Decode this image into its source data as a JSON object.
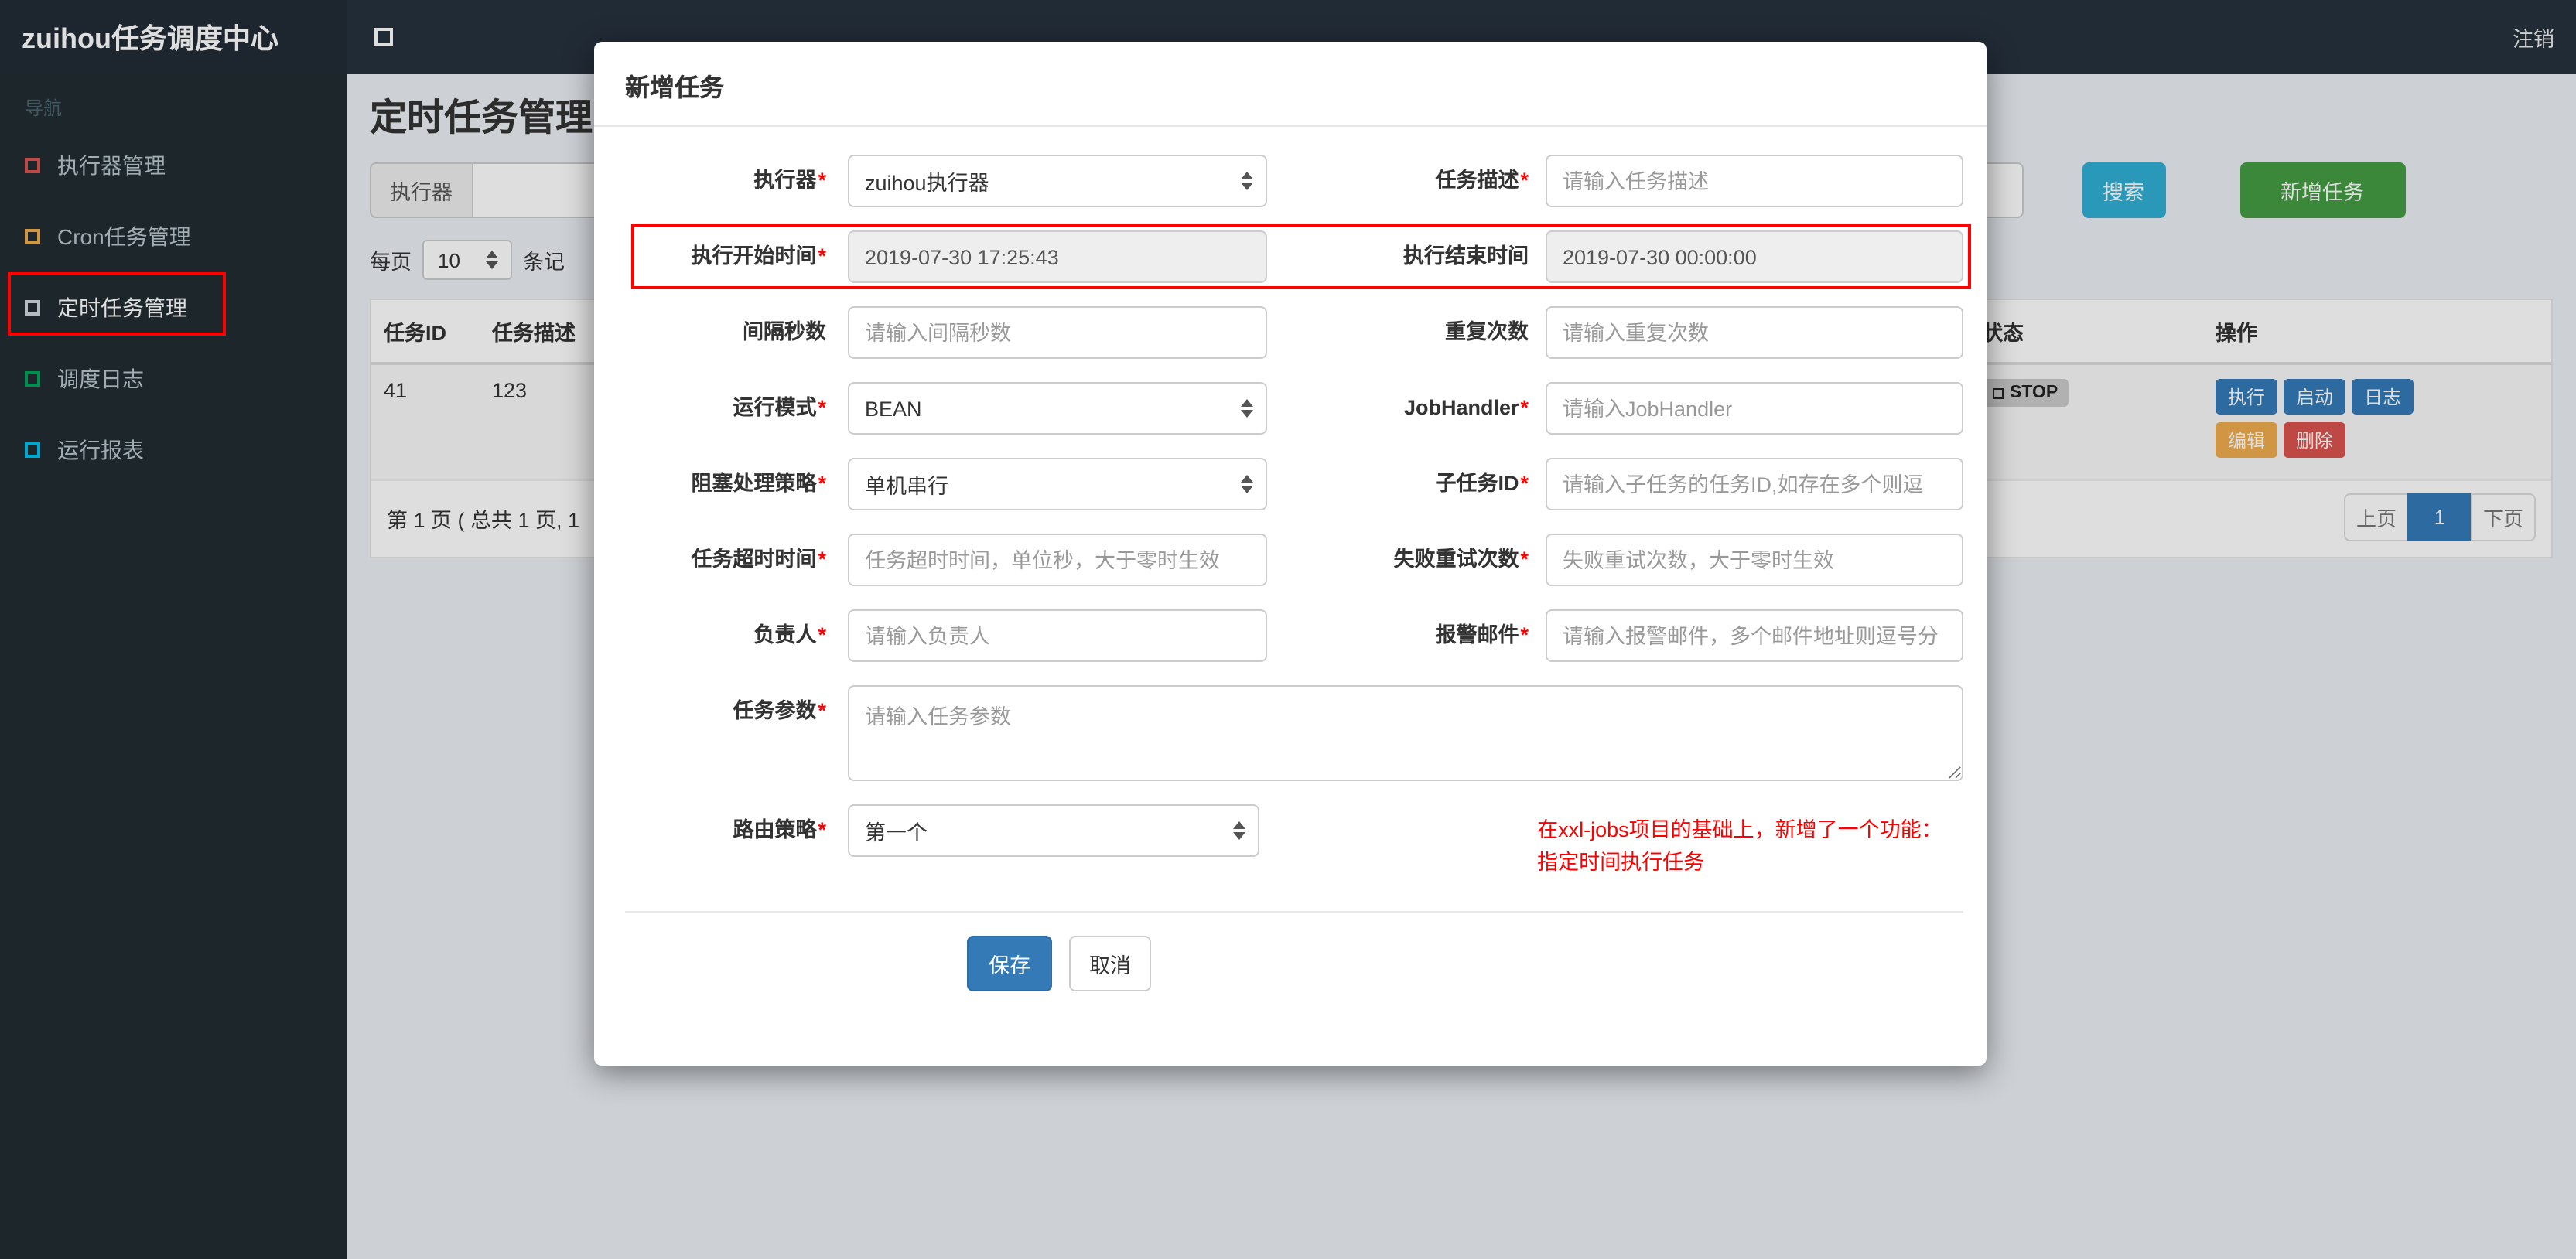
{
  "navbar": {
    "brand": "zuihou任务调度中心",
    "logout": "注销"
  },
  "sidebar": {
    "section_label": "导航",
    "items": [
      {
        "label": "执行器管理"
      },
      {
        "label": "Cron任务管理"
      },
      {
        "label": "定时任务管理"
      },
      {
        "label": "调度日志"
      },
      {
        "label": "运行报表"
      }
    ]
  },
  "page": {
    "title": "定时任务管理",
    "toolbar": {
      "filter_addon": "执行器",
      "search_label": "搜索",
      "add_label": "新增任务"
    },
    "per_page": {
      "prefix": "每页",
      "value": "10",
      "suffix": "条记"
    },
    "table": {
      "headers": [
        "任务ID",
        "任务描述",
        "状态",
        "操作"
      ],
      "row": {
        "id": "41",
        "description": "123",
        "status": "STOP",
        "actions": [
          {
            "label": "执行"
          },
          {
            "label": "启动"
          },
          {
            "label": "日志"
          },
          {
            "label": "编辑"
          },
          {
            "label": "删除"
          }
        ]
      }
    },
    "pagination": {
      "summary": "第 1 页 ( 总共 1 页, 1",
      "prev": "上页",
      "page": "1",
      "next": "下页"
    }
  },
  "modal": {
    "title": "新增任务",
    "required_marker": "*",
    "rows": [
      {
        "left": {
          "label": "执行器",
          "value": "zuihou执行器"
        },
        "right": {
          "label": "任务描述",
          "placeholder": "请输入任务描述"
        }
      },
      {
        "left": {
          "label": "执行开始时间",
          "value": "2019-07-30 17:25:43"
        },
        "right": {
          "label": "执行结束时间",
          "value": "2019-07-30 00:00:00"
        }
      },
      {
        "left": {
          "label": "间隔秒数",
          "placeholder": "请输入间隔秒数"
        },
        "right": {
          "label": "重复次数",
          "placeholder": "请输入重复次数"
        }
      },
      {
        "left": {
          "label": "运行模式",
          "value": "BEAN"
        },
        "right": {
          "label": "JobHandler",
          "placeholder": "请输入JobHandler"
        }
      },
      {
        "left": {
          "label": "阻塞处理策略",
          "value": "单机串行"
        },
        "right": {
          "label": "子任务ID",
          "placeholder": "请输入子任务的任务ID,如存在多个则逗"
        }
      },
      {
        "left": {
          "label": "任务超时时间",
          "placeholder": "任务超时时间，单位秒，大于零时生效"
        },
        "right": {
          "label": "失败重试次数",
          "placeholder": "失败重试次数，大于零时生效"
        }
      },
      {
        "left": {
          "label": "负责人",
          "placeholder": "请输入负责人"
        },
        "right": {
          "label": "报警邮件",
          "placeholder": "请输入报警邮件，多个邮件地址则逗号分"
        }
      },
      {
        "left": {
          "label": "任务参数",
          "placeholder": "请输入任务参数"
        }
      },
      {
        "left": {
          "label": "路由策略",
          "value": "第一个"
        }
      }
    ],
    "note_line1": "在xxl-jobs项目的基础上，新增了一个功能：",
    "note_line2": "指定时间执行任务",
    "save_label": "保存",
    "cancel_label": "取消"
  },
  "colors": {
    "primary": "#337ab7",
    "info": "#31b0d5",
    "success": "#449d44",
    "warning": "#f0ad4e",
    "danger": "#d9534f",
    "annotation": "#ff0000",
    "note_text": "#ff0000",
    "navbar_bg": "#26323e",
    "brand_bg": "#222c37",
    "sidebar_bg": "#222d32",
    "page_bg": "#ecf0f5"
  }
}
